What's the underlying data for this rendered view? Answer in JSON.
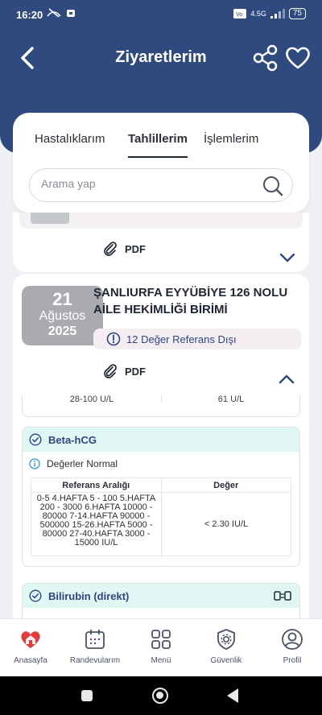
{
  "status_bar": {
    "time": "16:20",
    "network": "4.5G",
    "battery": "75"
  },
  "header": {
    "title": "Ziyaretlerim"
  },
  "tabs": [
    {
      "label": "Hastalıklarım",
      "active": false
    },
    {
      "label": "Tahlillerim",
      "active": true
    },
    {
      "label": "İşlemlerim",
      "active": false
    }
  ],
  "search": {
    "placeholder": "Arama yap"
  },
  "visits": [
    {
      "pdf_label": "PDF",
      "expanded": false
    },
    {
      "date": {
        "day": "21",
        "month": "Ağustos",
        "year": "2025"
      },
      "clinic": "ŞANLIURFA EYYÜBİYE 126 NOLU AİLE HEKİMLİĞİ BİRİMİ",
      "ref_badge": "12 Değer Referans Dışı",
      "pdf_label": "PDF",
      "expanded": true,
      "prev_row": {
        "reference": "28-100 U/L",
        "value": "61 U/L"
      },
      "tests": [
        {
          "name": "Beta-hCG",
          "status": "Değerler Normal",
          "col_ref": "Referans Aralığı",
          "col_val": "Değer",
          "reference": "0-5 4.HAFTA 5 - 100 5.HAFTA 200 - 3000 6.HAFTA 10000 - 80000 7-14.HAFTA 90000 - 500000 15-26.HAFTA 5000 - 80000 27-40.HAFTA 3000 - 15000 IU/L",
          "value": "< 2.30 IU/L"
        },
        {
          "name": "Bilirubin (direkt)"
        }
      ]
    }
  ],
  "bottom_nav": [
    {
      "label": "Anasayfa",
      "icon": "home-heart-icon"
    },
    {
      "label": "Randevularım",
      "icon": "calendar-icon"
    },
    {
      "label": "Menü",
      "icon": "grid-menu-icon"
    },
    {
      "label": "Güvenlik",
      "icon": "shield-gear-icon"
    },
    {
      "label": "Profil",
      "icon": "user-icon"
    }
  ],
  "colors": {
    "header": "#2f4a7f",
    "accent": "#2e4780",
    "test_header": "#e0f6f3",
    "ref_badge_bg": "#f4eef3"
  }
}
